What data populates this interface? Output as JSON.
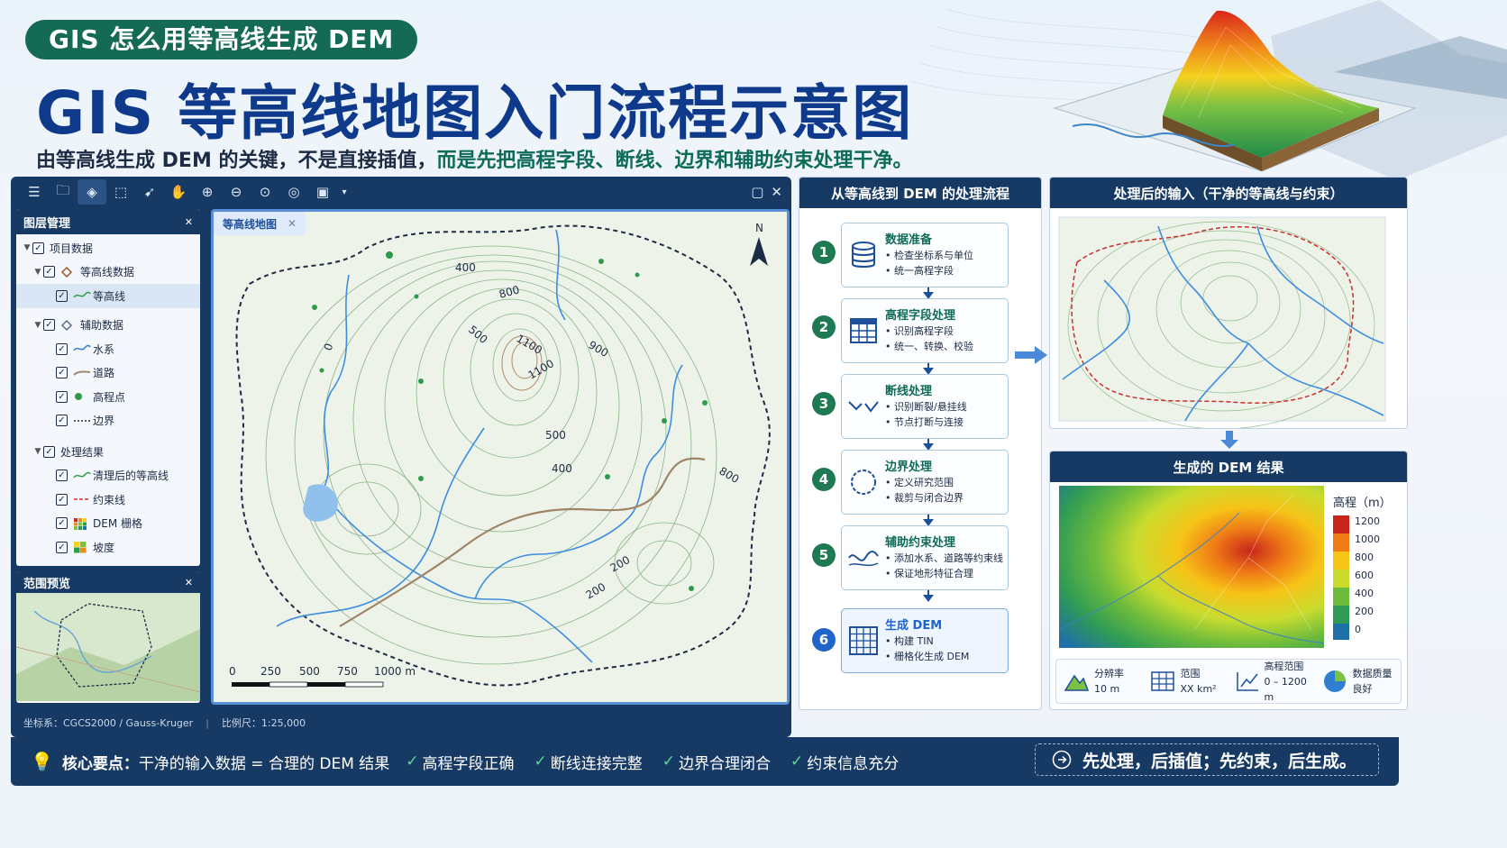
{
  "header": {
    "pill": "GIS 怎么用等高线生成 DEM",
    "title": "GIS 等高线地图入门流程示意图",
    "subtitle_plain": "由等高线生成 DEM 的关键，不是直接插值，",
    "subtitle_highlight": "而是先把高程字段、断线、边界和辅助约束处理干净。"
  },
  "layer_panel": {
    "title": "图层管理",
    "items": [
      {
        "label": "项目数据",
        "level": 0
      },
      {
        "label": "等高线数据",
        "level": 1
      },
      {
        "label": "等高线",
        "level": 2
      },
      {
        "label": "辅助数据",
        "level": 1
      },
      {
        "label": "水系",
        "level": 2
      },
      {
        "label": "道路",
        "level": 2
      },
      {
        "label": "高程点",
        "level": 2
      },
      {
        "label": "边界",
        "level": 2
      },
      {
        "label": "处理结果",
        "level": 1
      },
      {
        "label": "清理后的等高线",
        "level": 2
      },
      {
        "label": "约束线",
        "level": 2
      },
      {
        "label": "DEM 栅格",
        "level": 2
      },
      {
        "label": "坡度",
        "level": 2
      }
    ]
  },
  "overview_panel": {
    "title": "范围预览"
  },
  "map": {
    "tab": "等高线地图",
    "north": "N",
    "labels": [
      "400",
      "800",
      "900",
      "1100",
      "1100",
      "500",
      "500",
      "400",
      "200",
      "200",
      "800",
      "0"
    ],
    "scale_labels": [
      "0",
      "250",
      "500",
      "750",
      "1000 m"
    ]
  },
  "status": {
    "crs": "坐标系：CGCS2000 / Gauss-Kruger",
    "scale": "比例尺：1:25,000"
  },
  "flow": {
    "title": "从等高线到 DEM 的处理流程",
    "steps": [
      {
        "num": "1",
        "title": "数据准备",
        "lines": [
          "• 检查坐标系与单位",
          "• 统一高程字段"
        ],
        "icon": "database-icon"
      },
      {
        "num": "2",
        "title": "高程字段处理",
        "lines": [
          "• 识别高程字段",
          "• 统一、转换、校验"
        ],
        "icon": "table-icon"
      },
      {
        "num": "3",
        "title": "断线处理",
        "lines": [
          "• 识别断裂/悬挂线",
          "• 节点打断与连接"
        ],
        "icon": "broken-line-icon"
      },
      {
        "num": "4",
        "title": "边界处理",
        "lines": [
          "• 定义研究范围",
          "• 裁剪与闭合边界"
        ],
        "icon": "boundary-icon"
      },
      {
        "num": "5",
        "title": "辅助约束处理",
        "lines": [
          "• 添加水系、道路等约束线",
          "• 保证地形特征合理"
        ],
        "icon": "constraint-icon"
      },
      {
        "num": "6",
        "title": "生成 DEM",
        "lines": [
          "• 构建 TIN",
          "• 栅格化生成 DEM"
        ],
        "icon": "grid-icon"
      }
    ]
  },
  "input_panel": {
    "title": "处理后的输入（干净的等高线与约束）"
  },
  "dem_panel": {
    "title": "生成的 DEM 结果",
    "legend_title": "高程（m）",
    "legend_values": [
      "1200",
      "1000",
      "800",
      "600",
      "400",
      "200",
      "0"
    ],
    "legend_colors": [
      "#c8261b",
      "#ef7a16",
      "#f6c317",
      "#c9dc2e",
      "#6cbb3c",
      "#2f9b55",
      "#1f6fa8"
    ],
    "stats": [
      {
        "label": "分辨率",
        "value": "10 m",
        "icon": "mountain-icon"
      },
      {
        "label": "范围",
        "value": "XX km²",
        "icon": "grid-icon"
      },
      {
        "label": "高程范围",
        "value": "0 – 1200 m",
        "icon": "bar-chart-icon"
      },
      {
        "label": "数据质量",
        "value": "良好",
        "icon": "pie-icon"
      }
    ]
  },
  "bottom": {
    "key_label": "核心要点：",
    "key_text": "干净的输入数据 = 合理的 DEM 结果",
    "checks": [
      "高程字段正确",
      "断线连接完整",
      "边界合理闭合",
      "约束信息充分"
    ],
    "motto": "先处理，后插值；先约束，后生成。"
  }
}
